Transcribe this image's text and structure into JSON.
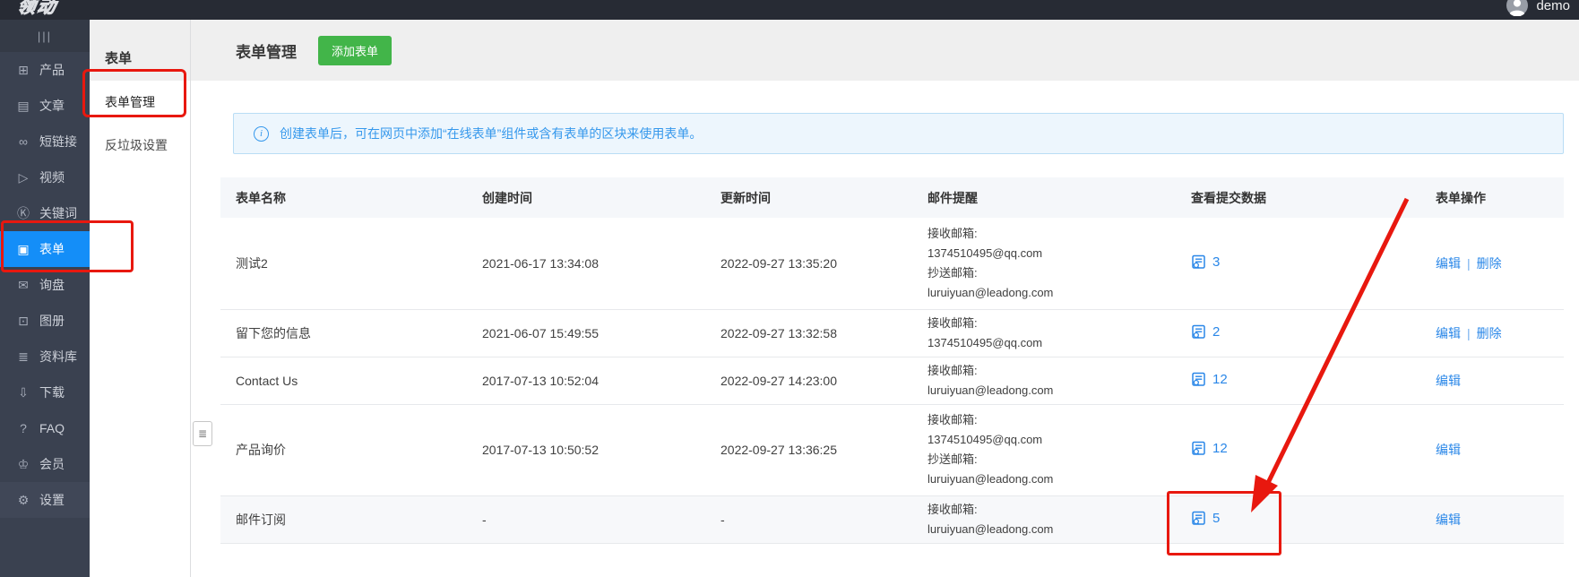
{
  "topbar": {
    "logo_text": "领动",
    "user_name": "demo"
  },
  "sidebar": {
    "menu_toggle_glyph": "|||",
    "items": [
      {
        "key": "products",
        "label": "产品",
        "icon": "grid-icon",
        "glyph": "⊞"
      },
      {
        "key": "articles",
        "label": "文章",
        "icon": "article-icon",
        "glyph": "▤"
      },
      {
        "key": "short-links",
        "label": "短链接",
        "icon": "link-icon",
        "glyph": "∞"
      },
      {
        "key": "videos",
        "label": "视频",
        "icon": "video-icon",
        "glyph": "▷"
      },
      {
        "key": "keywords",
        "label": "关键词",
        "icon": "keyword-icon",
        "glyph": "Ⓚ"
      },
      {
        "key": "forms",
        "label": "表单",
        "icon": "form-icon",
        "glyph": "▣",
        "active": true
      },
      {
        "key": "inquiries",
        "label": "询盘",
        "icon": "inquiry-icon",
        "glyph": "✉"
      },
      {
        "key": "albums",
        "label": "图册",
        "icon": "gallery-icon",
        "glyph": "⊡"
      },
      {
        "key": "library",
        "label": "资料库",
        "icon": "library-icon",
        "glyph": "≣"
      },
      {
        "key": "downloads",
        "label": "下载",
        "icon": "download-icon",
        "glyph": "⇩"
      },
      {
        "key": "faq",
        "label": "FAQ",
        "icon": "question-icon",
        "glyph": "?"
      },
      {
        "key": "members",
        "label": "会员",
        "icon": "crown-icon",
        "glyph": "♔"
      },
      {
        "key": "settings",
        "label": "设置",
        "icon": "gear-icon",
        "glyph": "⚙",
        "footer": true
      }
    ]
  },
  "subsidebar": {
    "title": "表单",
    "items": [
      {
        "key": "form-management",
        "label": "表单管理",
        "active": true
      },
      {
        "key": "anti-spam",
        "label": "反垃圾设置",
        "active": false
      }
    ]
  },
  "page": {
    "title": "表单管理",
    "add_button_label": "添加表单",
    "info_banner": "创建表单后，可在网页中添加“在线表单”组件或含有表单的区块来使用表单。"
  },
  "table": {
    "headers": [
      "表单名称",
      "创建时间",
      "更新时间",
      "邮件提醒",
      "查看提交数据",
      "表单操作"
    ],
    "rows": [
      {
        "name": "测试2",
        "created": "2021-06-17 13:34:08",
        "updated": "2022-09-27 13:35:20",
        "email_lines": [
          "接收邮箱:",
          "1374510495@qq.com",
          "抄送邮箱:",
          "luruiyuan@leadong.com"
        ],
        "submissions": "3",
        "actions": [
          {
            "key": "edit",
            "label": "编辑"
          },
          {
            "key": "delete",
            "label": "删除"
          }
        ]
      },
      {
        "name": "留下您的信息",
        "created": "2021-06-07 15:49:55",
        "updated": "2022-09-27 13:32:58",
        "email_lines": [
          "接收邮箱:",
          "1374510495@qq.com"
        ],
        "submissions": "2",
        "actions": [
          {
            "key": "edit",
            "label": "编辑"
          },
          {
            "key": "delete",
            "label": "删除"
          }
        ]
      },
      {
        "name": "Contact Us",
        "created": "2017-07-13 10:52:04",
        "updated": "2022-09-27 14:23:00",
        "email_lines": [
          "接收邮箱:",
          "luruiyuan@leadong.com"
        ],
        "submissions": "12",
        "actions": [
          {
            "key": "edit",
            "label": "编辑"
          }
        ]
      },
      {
        "name": "产品询价",
        "created": "2017-07-13 10:50:52",
        "updated": "2022-09-27 13:36:25",
        "email_lines": [
          "接收邮箱:",
          "1374510495@qq.com",
          "抄送邮箱:",
          "luruiyuan@leadong.com"
        ],
        "submissions": "12",
        "actions": [
          {
            "key": "edit",
            "label": "编辑"
          }
        ]
      },
      {
        "name": "邮件订阅",
        "created": "-",
        "updated": "-",
        "email_lines": [
          "接收邮箱:",
          "luruiyuan@leadong.com"
        ],
        "submissions": "5",
        "shaded": true,
        "actions": [
          {
            "key": "edit",
            "label": "编辑"
          }
        ]
      }
    ]
  },
  "annotations": {
    "color": "#e8180f",
    "items": [
      "sidebar-forms-highlight-box",
      "form-management-highlight-box",
      "submissions-count-highlight-box",
      "arrow-to-submissions-count"
    ]
  },
  "colors": {
    "topbar_bg": "#272b34",
    "sidebar_bg": "#3a4150",
    "sidebar_active_blue": "#148ef8",
    "accent_blue": "#2a87e8",
    "banner_text_blue": "#3598ec",
    "button_green": "#42b549",
    "annotation_red": "#e8180f",
    "header_band_gray": "#efefef",
    "table_head_bg": "#f5f7fa"
  }
}
